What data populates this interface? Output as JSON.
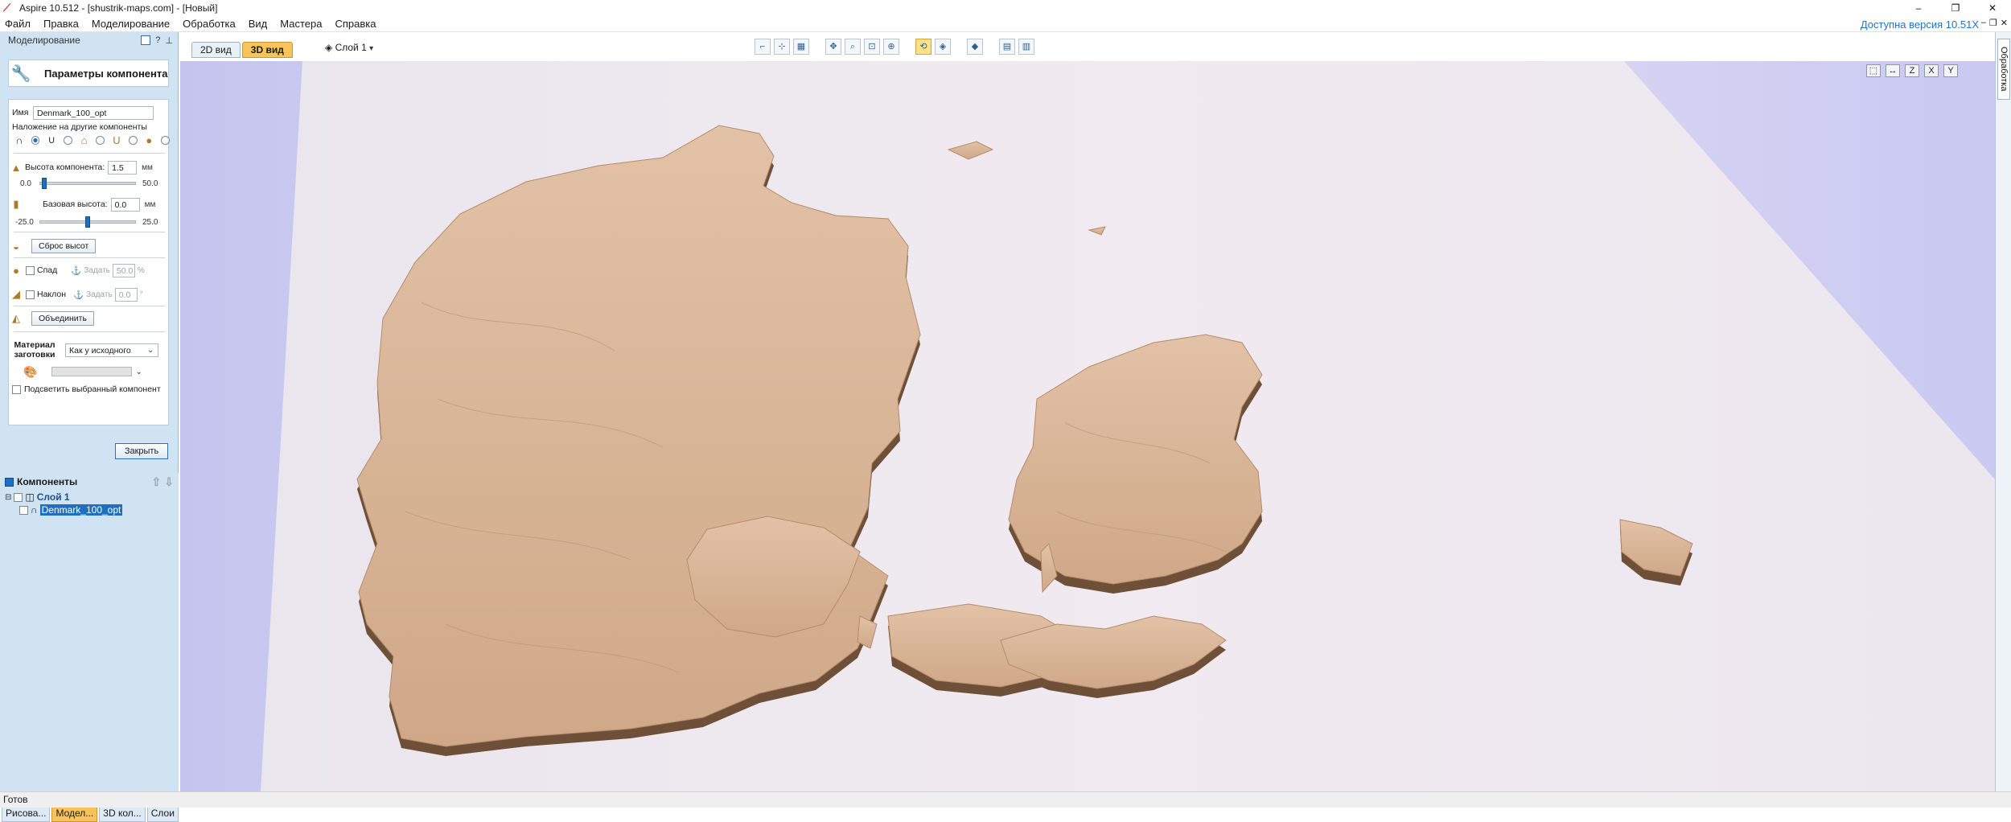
{
  "window": {
    "title": "Aspire 10.512 - [shustrik-maps.com] - [Новый]",
    "controls": [
      "–",
      "❐",
      "✕"
    ]
  },
  "menu": {
    "items": [
      "Файл",
      "Правка",
      "Моделирование",
      "Обработка",
      "Вид",
      "Мастера",
      "Справка"
    ],
    "upgrade": "Доступна версия 10.51X"
  },
  "panel": {
    "title": "Моделирование",
    "heading": "Параметры компонента",
    "name_label": "Имя",
    "name_value": "Denmark_100_opt",
    "overlay_label": "Наложение на другие компоненты",
    "height_label": "Высота компонента:",
    "height_value": "1.5",
    "unit_mm": "мм",
    "height_min": "0.0",
    "height_max": "50.0",
    "base_label": "Базовая высота:",
    "base_value": "0.0",
    "base_min": "-25.0",
    "base_max": "25.0",
    "reset_button": "Сброс высот",
    "fade_label": "Спад",
    "set_label": "Задать",
    "fade_value": "50.0",
    "fade_unit": "%",
    "tilt_label": "Наклон",
    "tilt_value": "0.0",
    "tilt_unit": "°",
    "merge_button": "Объединить",
    "material_label": "Материал заготовки",
    "material_value": "Как у исходного",
    "highlight_label": "Подсветить выбранный компонент",
    "close_button": "Закрыть"
  },
  "components": {
    "title": "Компоненты",
    "layer": "Слой 1",
    "item": "Denmark_100_opt"
  },
  "bottom_tabs": [
    "Рисова...",
    "Модел...",
    "3D кол...",
    "Слои"
  ],
  "view": {
    "tabs": [
      "2D вид",
      "3D вид"
    ],
    "layer_selector": "Слой 1",
    "view_buttons": [
      "⬚",
      "↔",
      "Z",
      "X",
      "Y"
    ]
  },
  "right_tab": "Обработка",
  "status": "Готов",
  "colors": {
    "accent": "#1d6fc1",
    "tab_active": "#f7c35a",
    "relief": "#d8b597"
  }
}
